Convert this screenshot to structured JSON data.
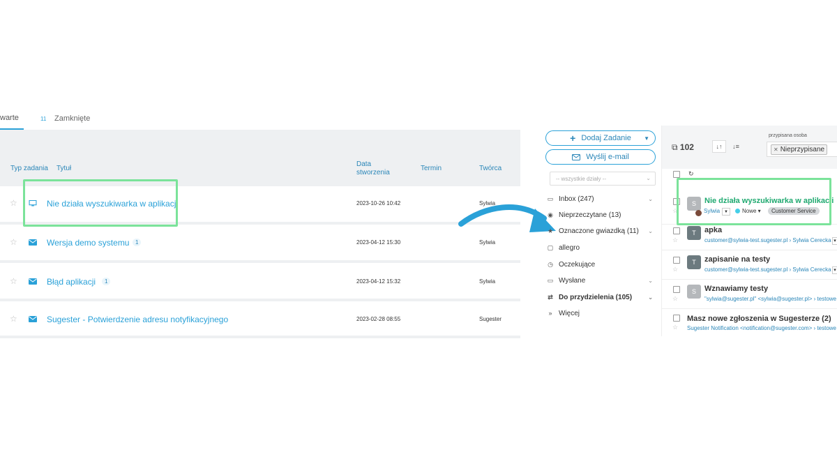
{
  "tabs": {
    "open_label": "warte",
    "closed_count": "11",
    "closed_label": "Zamknięte"
  },
  "table": {
    "headers": {
      "type": "Typ zadania",
      "title": "Tytuł",
      "date_line1": "Data",
      "date_line2": "stworzenia",
      "deadline": "Termin",
      "creator": "Twórca"
    },
    "rows": [
      {
        "type_icon": "monitor-icon",
        "title": "Nie działa wyszukiwarka w aplikacji",
        "badge": "",
        "date": "2023-10-26 10:42",
        "creator": "Sylwia"
      },
      {
        "type_icon": "envelope-icon",
        "title": "Wersja demo systemu",
        "badge": "1",
        "date": "2023-04-12 15:30",
        "creator": "Sylwia"
      },
      {
        "type_icon": "envelope-icon",
        "title": "Błąd aplikacji",
        "badge": "1",
        "date": "2023-04-12 15:32",
        "creator": "Sylwia"
      },
      {
        "type_icon": "envelope-icon",
        "title": "Sugester - Potwierdzenie adresu notyfikacyjnego",
        "badge": "",
        "date": "2023-02-28 08:55",
        "creator": "Sugester"
      }
    ]
  },
  "sidebar": {
    "add_task": "Dodaj Zadanie",
    "send_email": "Wyślij e-mail",
    "departments_placeholder": "-- wszystkie działy --",
    "items": [
      {
        "icon": "inbox-icon",
        "label": "Inbox (247)",
        "bold": false,
        "caret": true
      },
      {
        "icon": "eye-icon",
        "label": "Nieprzeczytane (13)",
        "bold": false,
        "caret": false
      },
      {
        "icon": "star-icon",
        "label": "Oznaczone gwiazdką (11)",
        "bold": false,
        "caret": true
      },
      {
        "icon": "folder-icon",
        "label": "allegro",
        "bold": false,
        "caret": false
      },
      {
        "icon": "clock-icon",
        "label": "Oczekujące",
        "bold": false,
        "caret": false
      },
      {
        "icon": "outbox-icon",
        "label": "Wysłane",
        "bold": false,
        "caret": true
      },
      {
        "icon": "swap-icon",
        "label": "Do przydzielenia (105)",
        "bold": true,
        "caret": true
      },
      {
        "icon": "chevrons-down-icon",
        "label": "Więcej",
        "bold": false,
        "caret": false
      }
    ]
  },
  "list": {
    "count": "102",
    "assigned_label": "przypisana osoba",
    "assigned_value": "Nieprzypisane",
    "items": [
      {
        "avatar": "S",
        "title": "Nie działa wyszukiwarka w aplikacji",
        "user": "Sylwia",
        "status": "Nowe",
        "tag": "Customer Service"
      },
      {
        "avatar": "T",
        "title": "apka",
        "sub": "customer@sylwia-test.sugester.pl › Sylwia Cerecka"
      },
      {
        "avatar": "T",
        "title": "zapisanie na testy",
        "sub": "customer@sylwia-test.sugester.pl › Sylwia Cerecka"
      },
      {
        "avatar": "S",
        "title": "Wznawiamy testy",
        "sub": "\"sylwia@sugester.pl\" <sylwia@sugester.pl> › testowe"
      },
      {
        "avatar": "",
        "title": "Masz nowe zgłoszenia w Sugesterze (2)",
        "sub": "Sugester Notification <notification@sugester.com> › testowe"
      }
    ]
  },
  "colors": {
    "accent": "#2aa1d8",
    "highlight": "#7be39a",
    "green_title": "#1fa970"
  }
}
